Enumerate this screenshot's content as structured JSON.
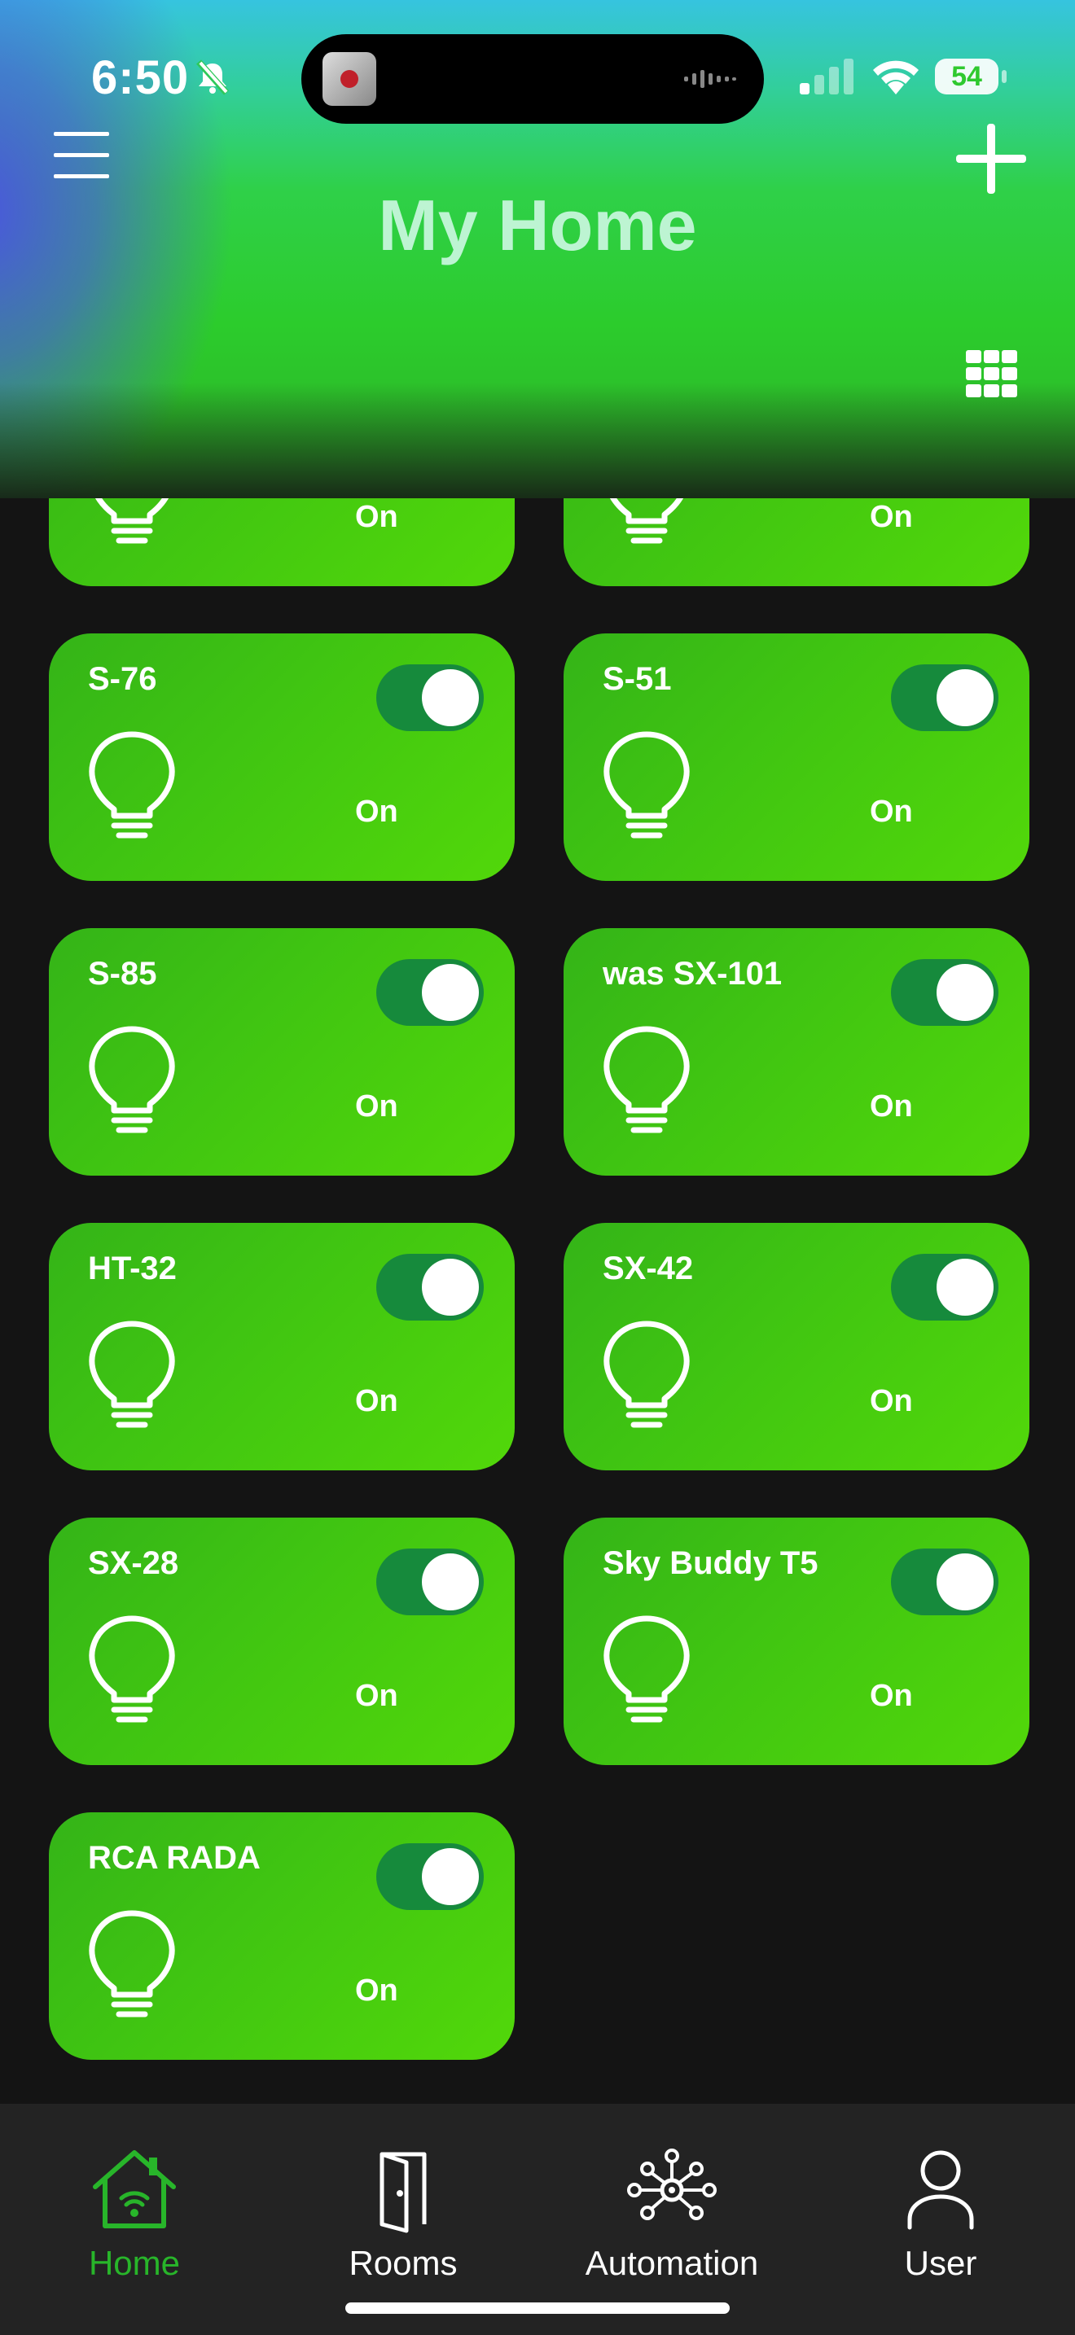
{
  "status_bar": {
    "time": "6:50",
    "battery": "54"
  },
  "header": {
    "title": "My Home"
  },
  "devices": [
    {
      "name": "",
      "status": "On",
      "on": true
    },
    {
      "name": "",
      "status": "On",
      "on": true
    },
    {
      "name": "S-76",
      "status": "On",
      "on": true
    },
    {
      "name": "S-51",
      "status": "On",
      "on": true
    },
    {
      "name": "S-85",
      "status": "On",
      "on": true
    },
    {
      "name": "was SX-101",
      "status": "On",
      "on": true
    },
    {
      "name": "HT-32",
      "status": "On",
      "on": true
    },
    {
      "name": "SX-42",
      "status": "On",
      "on": true
    },
    {
      "name": "SX-28",
      "status": "On",
      "on": true
    },
    {
      "name": "Sky Buddy T5",
      "status": "On",
      "on": true
    },
    {
      "name": "RCA RADA",
      "status": "On",
      "on": true
    }
  ],
  "nav": [
    {
      "label": "Home",
      "icon": "home-icon",
      "active": true
    },
    {
      "label": "Rooms",
      "icon": "door-icon",
      "active": false
    },
    {
      "label": "Automation",
      "icon": "automation-icon",
      "active": false
    },
    {
      "label": "User",
      "icon": "user-icon",
      "active": false
    }
  ],
  "colors": {
    "card_green": "#3fc412",
    "toggle_on": "#168a3c",
    "nav_active": "#28b52a",
    "background": "#141414"
  }
}
